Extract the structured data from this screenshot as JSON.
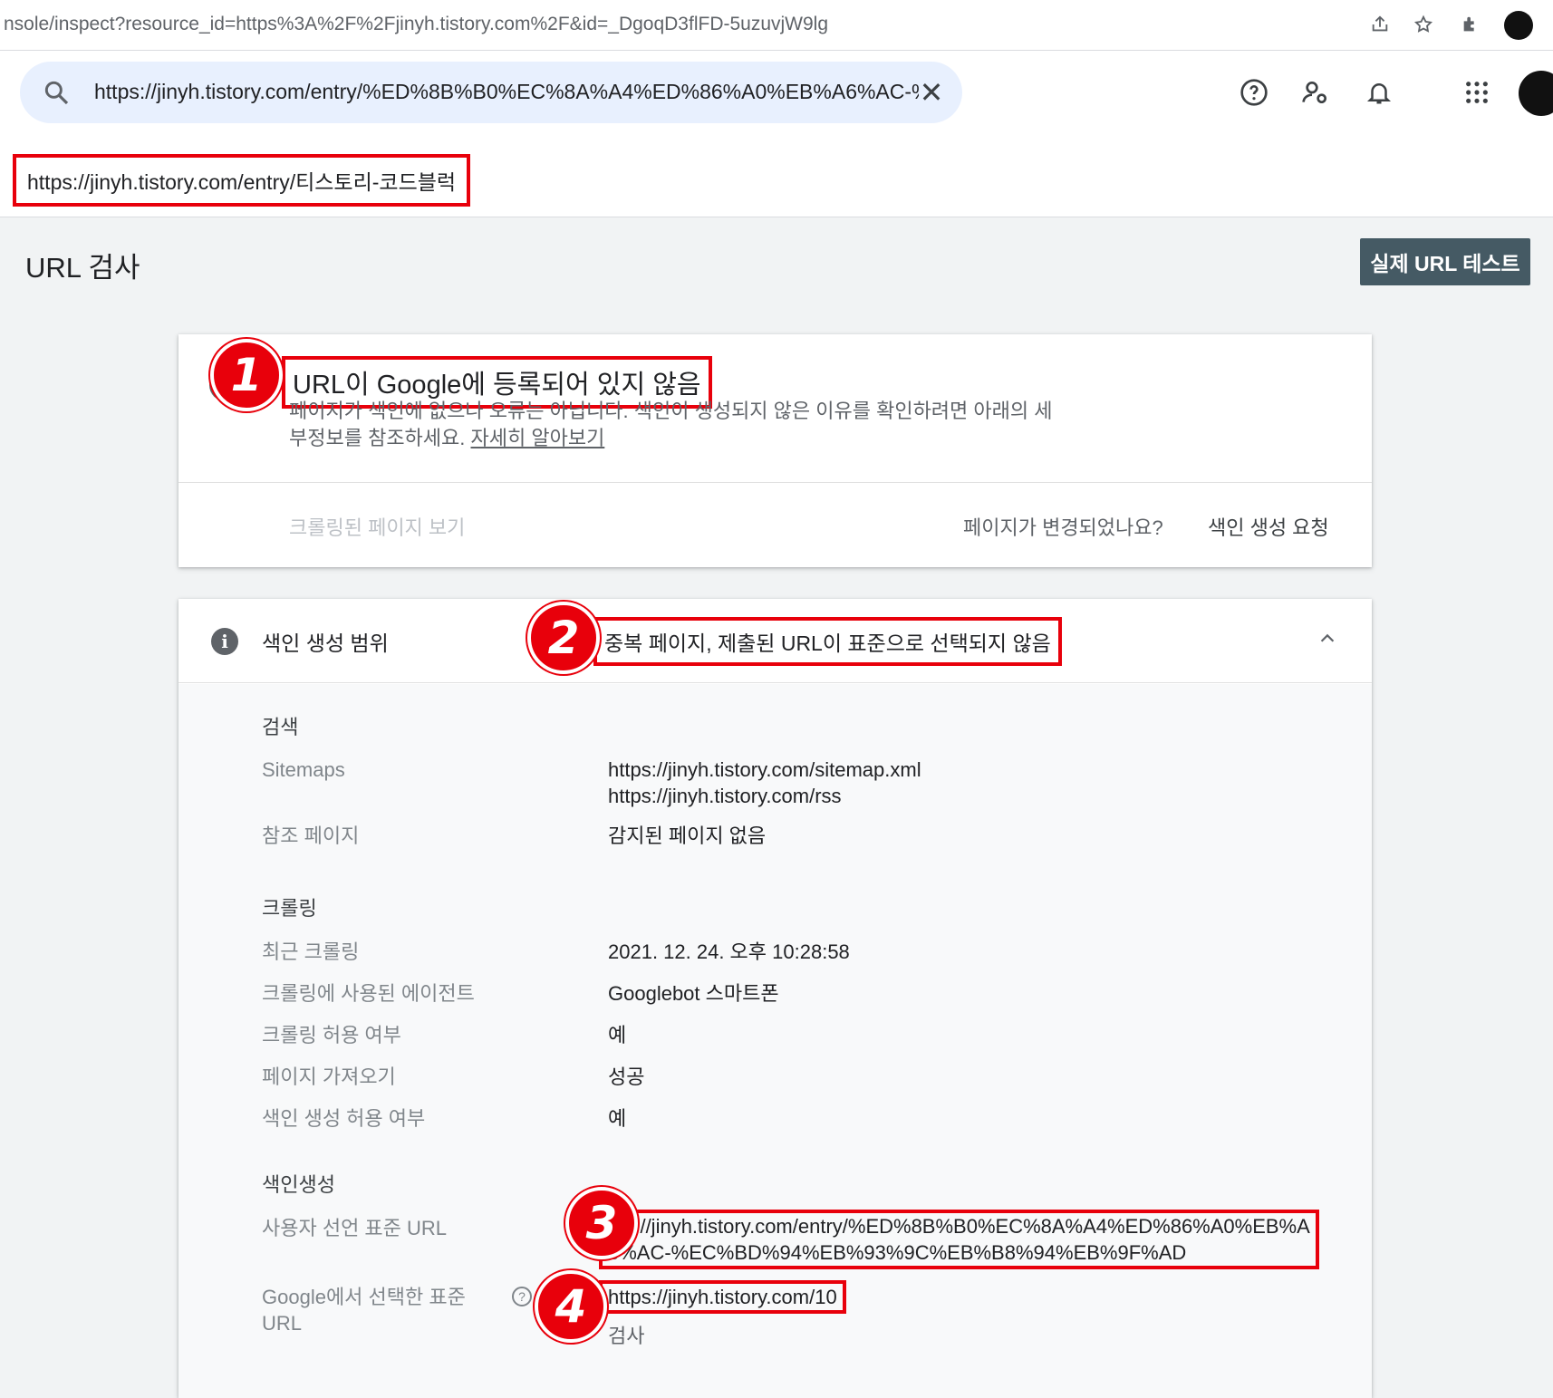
{
  "browser": {
    "address": "nsole/inspect?resource_id=https%3A%2F%2Fjinyh.tistory.com%2F&id=_DgoqD3flFD-5uzuvjW9lg",
    "icons": [
      "share-icon",
      "star-icon",
      "extensions-icon",
      "profile-avatar"
    ]
  },
  "topbar": {
    "search_value": "https://jinyh.tistory.com/entry/%ED%8B%B0%EC%8A%A4%ED%86%A0%EB%A6%AC-%",
    "clear_symbol": "✕",
    "icons": [
      "help-icon",
      "manage-users-icon",
      "notifications-icon",
      "apps-grid-icon",
      "account-avatar"
    ]
  },
  "page_url": "https://jinyh.tistory.com/entry/티스토리-코드블럭",
  "title": "URL 검사",
  "live_test_button": "실제 URL 테스트",
  "status_card": {
    "badge": "1",
    "title": "URL이 Google에 등록되어 있지 않음",
    "description": "페이지가 색인에 없으나 오류는 아닙니다. 색인이 생성되지 않은 이유를 확인하려면 아래의 세부정보를 참조하세요.",
    "learn_more": "자세히 알아보기",
    "view_crawled": "크롤링된 페이지 보기",
    "page_changed": "페이지가 변경되었나요?",
    "request_indexing": "색인 생성 요청"
  },
  "coverage_card": {
    "badge": "2",
    "label": "색인 생성 범위",
    "status": "중복 페이지, 제출된 URL이 표준으로 선택되지 않음",
    "sections": {
      "discovery": {
        "title": "검색",
        "sitemaps_label": "Sitemaps",
        "sitemaps": [
          "https://jinyh.tistory.com/sitemap.xml",
          "https://jinyh.tistory.com/rss"
        ],
        "referring_label": "참조 페이지",
        "referring_value": "감지된 페이지 없음"
      },
      "crawl": {
        "title": "크롤링",
        "last_crawl_label": "최근 크롤링",
        "last_crawl_value": "2021. 12. 24. 오후 10:28:58",
        "agent_label": "크롤링에 사용된 에이전트",
        "agent_value": "Googlebot 스마트폰",
        "allowed_label": "크롤링 허용 여부",
        "allowed_value": "예",
        "fetch_label": "페이지 가져오기",
        "fetch_value": "성공",
        "indexing_allowed_label": "색인 생성 허용 여부",
        "indexing_allowed_value": "예"
      },
      "indexing": {
        "title": "색인생성",
        "badge3": "3",
        "badge4": "4",
        "user_canonical_label": "사용자 선언 표준 URL",
        "user_canonical_line1": "tps://jinyh.tistory.com/entry/%ED%8B%B0%EC%8A%A4%ED%86%A0%EB%A",
        "user_canonical_line2": "6%AC-%EC%BD%94%EB%93%9C%EB%B8%94%EB%9F%AD",
        "google_canonical_label": "Google에서 선택한 표준 URL",
        "google_canonical_value": "https://jinyh.tistory.com/10",
        "inspect_link": "검사"
      }
    }
  },
  "colors": {
    "highlight": "#e8000b",
    "search_bg": "#e8f0fe",
    "button_bg": "#455a64"
  }
}
